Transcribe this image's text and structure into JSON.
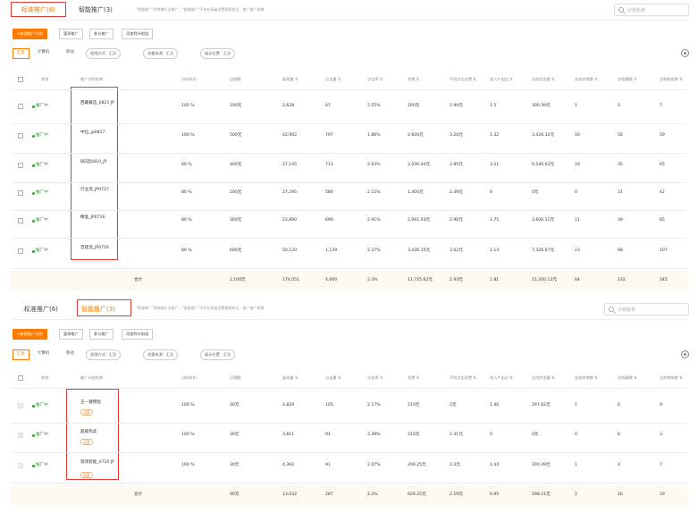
{
  "tabs": {
    "standard": "标准推广(6)",
    "smart": "智能推广(3)"
  },
  "note": "\"智能推广\"即电商行业推广，\"智能推广\"不存在高级设置搜索和全，推广推广效果",
  "search_placeholder": "计划名称",
  "toolbar": {
    "new_plan": "+新建推广计划",
    "pause": "暂停推广",
    "join": "参与推广",
    "add_plan": "添加到计划组"
  },
  "filter_tabs": [
    "汇总",
    "计算机",
    "移动"
  ],
  "dropdowns": [
    "权限方式：汇总",
    "流量来源：汇总",
    "展示位置：汇总"
  ],
  "headers": [
    "状态",
    "推广计划名称",
    "分时折扣",
    "日限额",
    "展现量 ⇅",
    "点击量 ⇅",
    "点击率 ⇅",
    "花费 ⇅",
    "平均点击花费 ⇅",
    "投入产出比 ⇅",
    "总成交金额 ⇅",
    "总成交笔数 ⇅",
    "总收藏数 ⇅",
    "总购物车数 ⇅"
  ],
  "table1": {
    "rows": [
      [
        "推广中",
        "西藏餐选_0821 JP",
        "100 %",
        "100元",
        "2,628",
        "67",
        "2.55%",
        "200元",
        "2.99元",
        "1.5",
        "300.39元",
        "1",
        "3",
        "7"
      ],
      [
        "推广中",
        "中位_jp0817",
        "100 %",
        "500元",
        "42,902",
        "797",
        "1.86%",
        "2,600元",
        "3.26元",
        "1.32",
        "3,426.32元",
        "10",
        "56",
        "59"
      ],
      [
        "推广中",
        "BD选0810_JP",
        "80 %",
        "400元",
        "27,145",
        "713",
        "2.63%",
        "2,036.44元",
        "2.85元",
        "3.21",
        "6,540.63元",
        "19",
        "35",
        "65"
      ],
      [
        "推广中",
        "行业流_JP0727",
        "80 %",
        "200元",
        "27,295",
        "586",
        "2.15%",
        "1,400元",
        "2.39元",
        "0",
        "0元",
        "0",
        "31",
        "42"
      ],
      [
        "推广中",
        "精准_JP0716",
        "80 %",
        "300元",
        "23,890",
        "696",
        "2.91%",
        "2,061.03元",
        "2.96元",
        "1.75",
        "3,606.11元",
        "11",
        "39",
        "65"
      ],
      [
        "推广中",
        "百建流_JP0716",
        "80 %",
        "600元",
        "50,120",
        "1,139",
        "2.27%",
        "3,436.15元",
        "3.02元",
        "2.13",
        "7,326.67元",
        "23",
        "68",
        "107"
      ]
    ],
    "total": [
      "合计",
      "",
      "2,100元",
      "174,051",
      "4,000",
      "2.3%",
      "11,725.62元",
      "2.93元",
      "1.81",
      "21,200.12元",
      "64",
      "232",
      "345"
    ]
  },
  "table2": {
    "rows": [
      [
        "推广中",
        "王一健用程",
        "100 %",
        "30元",
        "4,829",
        "105",
        "2.17%",
        "210元",
        "2元",
        "1.40",
        "297.62元",
        "1",
        "6",
        "9"
      ],
      [
        "推广中",
        "超级热卖",
        "100 %",
        "30元",
        "3,811",
        "91",
        "2.39%",
        "210元",
        "2.31元",
        "0",
        "0元",
        "0",
        "6",
        "3"
      ],
      [
        "推广中",
        "现场智能_0720 JP",
        "100 %",
        "30元",
        "4,392",
        "91",
        "2.07%",
        "209.25元",
        "2.3元",
        "1.44",
        "300.39元",
        "1",
        "4",
        "7"
      ]
    ],
    "tag": "运营",
    "total": [
      "合计",
      "",
      "90元",
      "13,032",
      "287",
      "2.2%",
      "629.25元",
      "2.19元",
      "0.95",
      "598.21元",
      "2",
      "16",
      "19"
    ]
  }
}
